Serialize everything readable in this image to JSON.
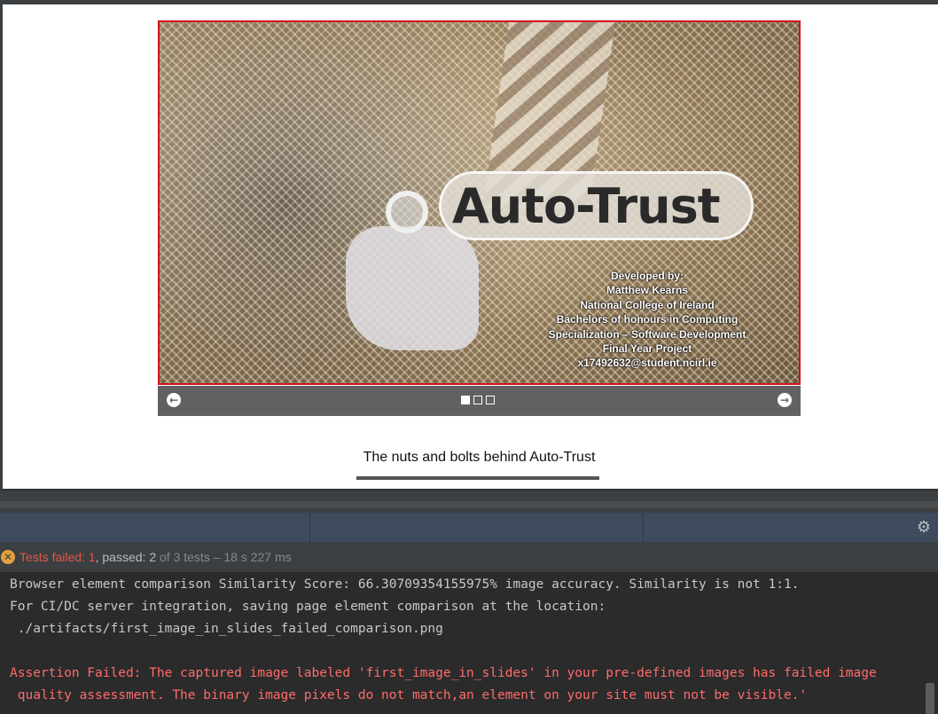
{
  "slideshow": {
    "title": "Auto-Trust",
    "credits": [
      "Developed by:",
      "Matthew Kearns",
      "National College of Ireland",
      "Bachelors of honours in Computing",
      "Specialization – Software Development",
      "Final Year Project",
      "x17492632@student.ncirl.ie"
    ],
    "prev_icon": "arrow-left-circle-icon",
    "next_icon": "arrow-right-circle-icon",
    "active_slide_index": 0,
    "slide_count": 3,
    "prev_glyph": "←",
    "next_glyph": "→"
  },
  "caption": "The nuts and bolts behind Auto-Trust",
  "colors": {
    "slide_border": "#d0141b",
    "controls_bg": "#616161",
    "fail_text": "#e0564a",
    "error_text": "#ff6b6b",
    "status_icon": "#e5a03f"
  },
  "test_status": {
    "icon": "error-x-icon",
    "failed_label": "Tests failed: 1",
    "separator": ", ",
    "passed_label": "passed: 2",
    "summary": " of 3 tests – 18 s 227 ms"
  },
  "toolstrip": {
    "settings_icon": "gear-icon"
  },
  "console": {
    "lines": [
      "Browser element comparison Similarity Score: 66.30709354155975% image accuracy. Similarity is not 1:1.",
      "For CI/DC server integration, saving page element comparison at the location:",
      " ./artifacts/first_image_in_slides_failed_comparison.png"
    ],
    "error_lines": [
      "Assertion Failed: The captured image labeled 'first_image_in_slides' in your pre-defined images has failed image",
      " quality assessment. The binary image pixels do not match,an element on your site must not be visible.'"
    ]
  }
}
